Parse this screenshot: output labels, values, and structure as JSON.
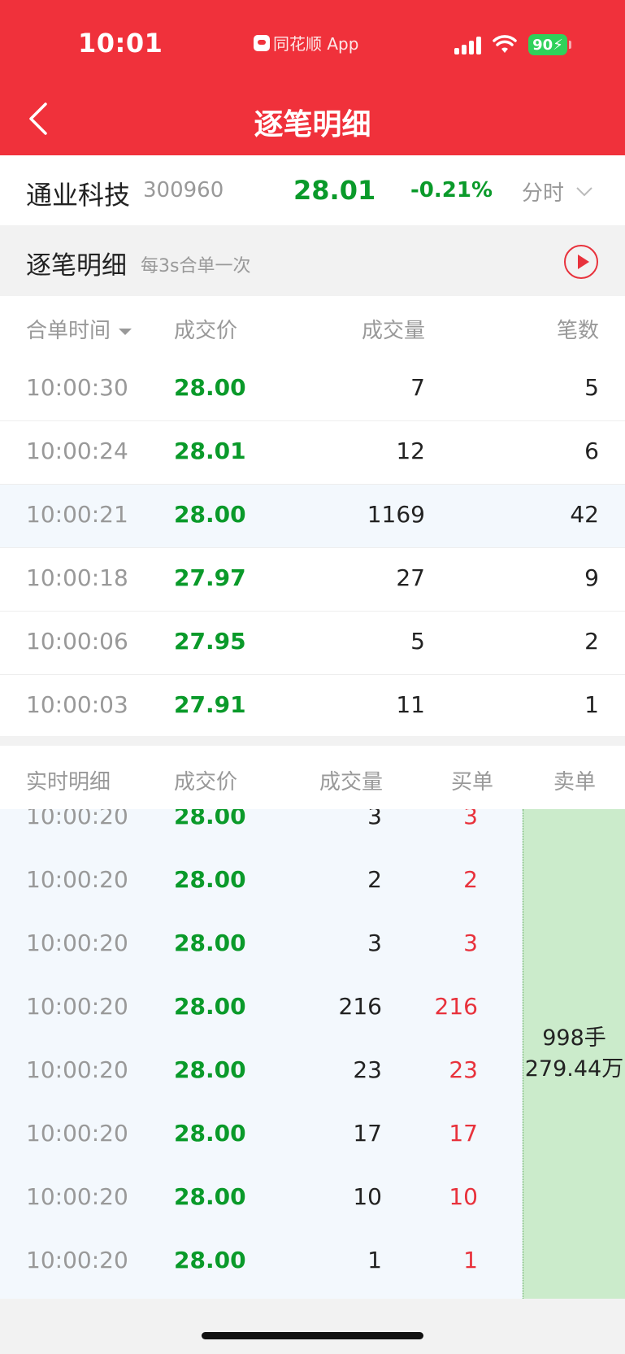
{
  "status": {
    "time": "10:01",
    "app_name": "同花顺 App",
    "battery": "90"
  },
  "header": {
    "title": "逐笔明细"
  },
  "stock": {
    "name": "通业科技",
    "code": "300960",
    "price": "28.01",
    "change": "-0.21%",
    "mode": "分时"
  },
  "section": {
    "title": "逐笔明细",
    "subtitle": "每3s合单一次"
  },
  "merge_table": {
    "headers": {
      "time": "合单时间",
      "price": "成交价",
      "volume": "成交量",
      "count": "笔数"
    },
    "rows": [
      {
        "time": "10:00:30",
        "price": "28.00",
        "volume": "7",
        "count": "5"
      },
      {
        "time": "10:00:24",
        "price": "28.01",
        "volume": "12",
        "count": "6"
      },
      {
        "time": "10:00:21",
        "price": "28.00",
        "volume": "1169",
        "count": "42"
      },
      {
        "time": "10:00:18",
        "price": "27.97",
        "volume": "27",
        "count": "9"
      },
      {
        "time": "10:00:06",
        "price": "27.95",
        "volume": "5",
        "count": "2"
      },
      {
        "time": "10:00:03",
        "price": "27.91",
        "volume": "11",
        "count": "1"
      }
    ]
  },
  "realtime_table": {
    "headers": {
      "time": "实时明细",
      "price": "成交价",
      "volume": "成交量",
      "buy": "买单",
      "sell": "卖单"
    },
    "rows": [
      {
        "time": "10:00:20",
        "price": "28.00",
        "volume": "3",
        "buy": "3"
      },
      {
        "time": "10:00:20",
        "price": "28.00",
        "volume": "2",
        "buy": "2"
      },
      {
        "time": "10:00:20",
        "price": "28.00",
        "volume": "3",
        "buy": "3"
      },
      {
        "time": "10:00:20",
        "price": "28.00",
        "volume": "216",
        "buy": "216"
      },
      {
        "time": "10:00:20",
        "price": "28.00",
        "volume": "23",
        "buy": "23"
      },
      {
        "time": "10:00:20",
        "price": "28.00",
        "volume": "17",
        "buy": "17"
      },
      {
        "time": "10:00:20",
        "price": "28.00",
        "volume": "10",
        "buy": "10"
      },
      {
        "time": "10:00:20",
        "price": "28.00",
        "volume": "1",
        "buy": "1"
      }
    ],
    "sell_summary": {
      "lots": "998手",
      "amount": "279.44万"
    }
  },
  "colors": {
    "brand_red": "#f0313b",
    "down_green": "#0a9a2a",
    "buy_red": "#e8323c",
    "sell_block": "#cbebcb"
  }
}
